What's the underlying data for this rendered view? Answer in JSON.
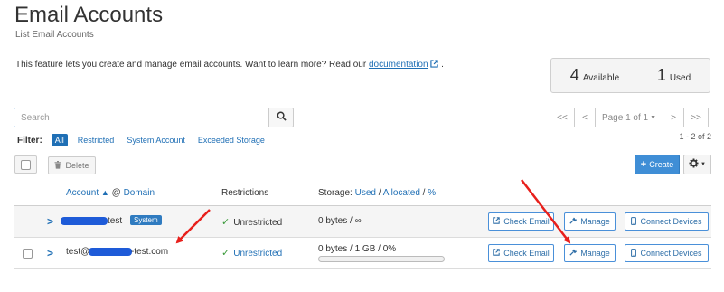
{
  "page": {
    "title": "Email Accounts",
    "subtitle": "List Email Accounts",
    "description_text": "This feature lets you create and manage email accounts. Want to learn more? Read our ",
    "documentation_link": "documentation",
    "description_end": " ."
  },
  "stats": {
    "available_count": "4",
    "available_label": "Available",
    "used_count": "1",
    "used_label": "Used"
  },
  "search": {
    "placeholder": "Search",
    "button_icon": "search-icon"
  },
  "filter": {
    "label": "Filter:",
    "items": [
      "All",
      "Restricted",
      "System Account",
      "Exceeded Storage"
    ],
    "active": "All"
  },
  "pagination": {
    "first": "<<",
    "prev": "<",
    "page_label": "Page 1 of 1",
    "next": ">",
    "last": ">>",
    "count_text": "1 - 2 of 2"
  },
  "toolbar": {
    "delete_label": "Delete",
    "create_label": "Create",
    "create_icon": "plus-icon",
    "settings_icon": "gear-icon"
  },
  "table": {
    "headers": {
      "account": "Account",
      "at": "@",
      "domain": "Domain",
      "restrictions": "Restrictions",
      "storage_prefix": "Storage:",
      "used": "Used",
      "allocated": "Allocated",
      "percent": "%"
    },
    "rows": [
      {
        "account": "test",
        "badge": "System",
        "restriction": "Unrestricted",
        "restriction_is_link": false,
        "storage": "0 bytes / ∞",
        "actions": [
          "Check Email",
          "Manage",
          "Connect Devices"
        ]
      },
      {
        "account_prefix": "test@",
        "account_suffix": "-test.com",
        "restriction": "Unrestricted",
        "restriction_is_link": true,
        "storage": "0 bytes / 1 GB / 0%",
        "usage_fraction": 0,
        "actions": [
          "Check Email",
          "Manage",
          "Connect Devices"
        ]
      }
    ]
  },
  "colors": {
    "link": "#1f6fb5",
    "primary_button": "#3f8ed6",
    "success_check": "#3a9a3a",
    "annotation_arrow": "#e8201c",
    "redaction": "#1e5bd8"
  }
}
